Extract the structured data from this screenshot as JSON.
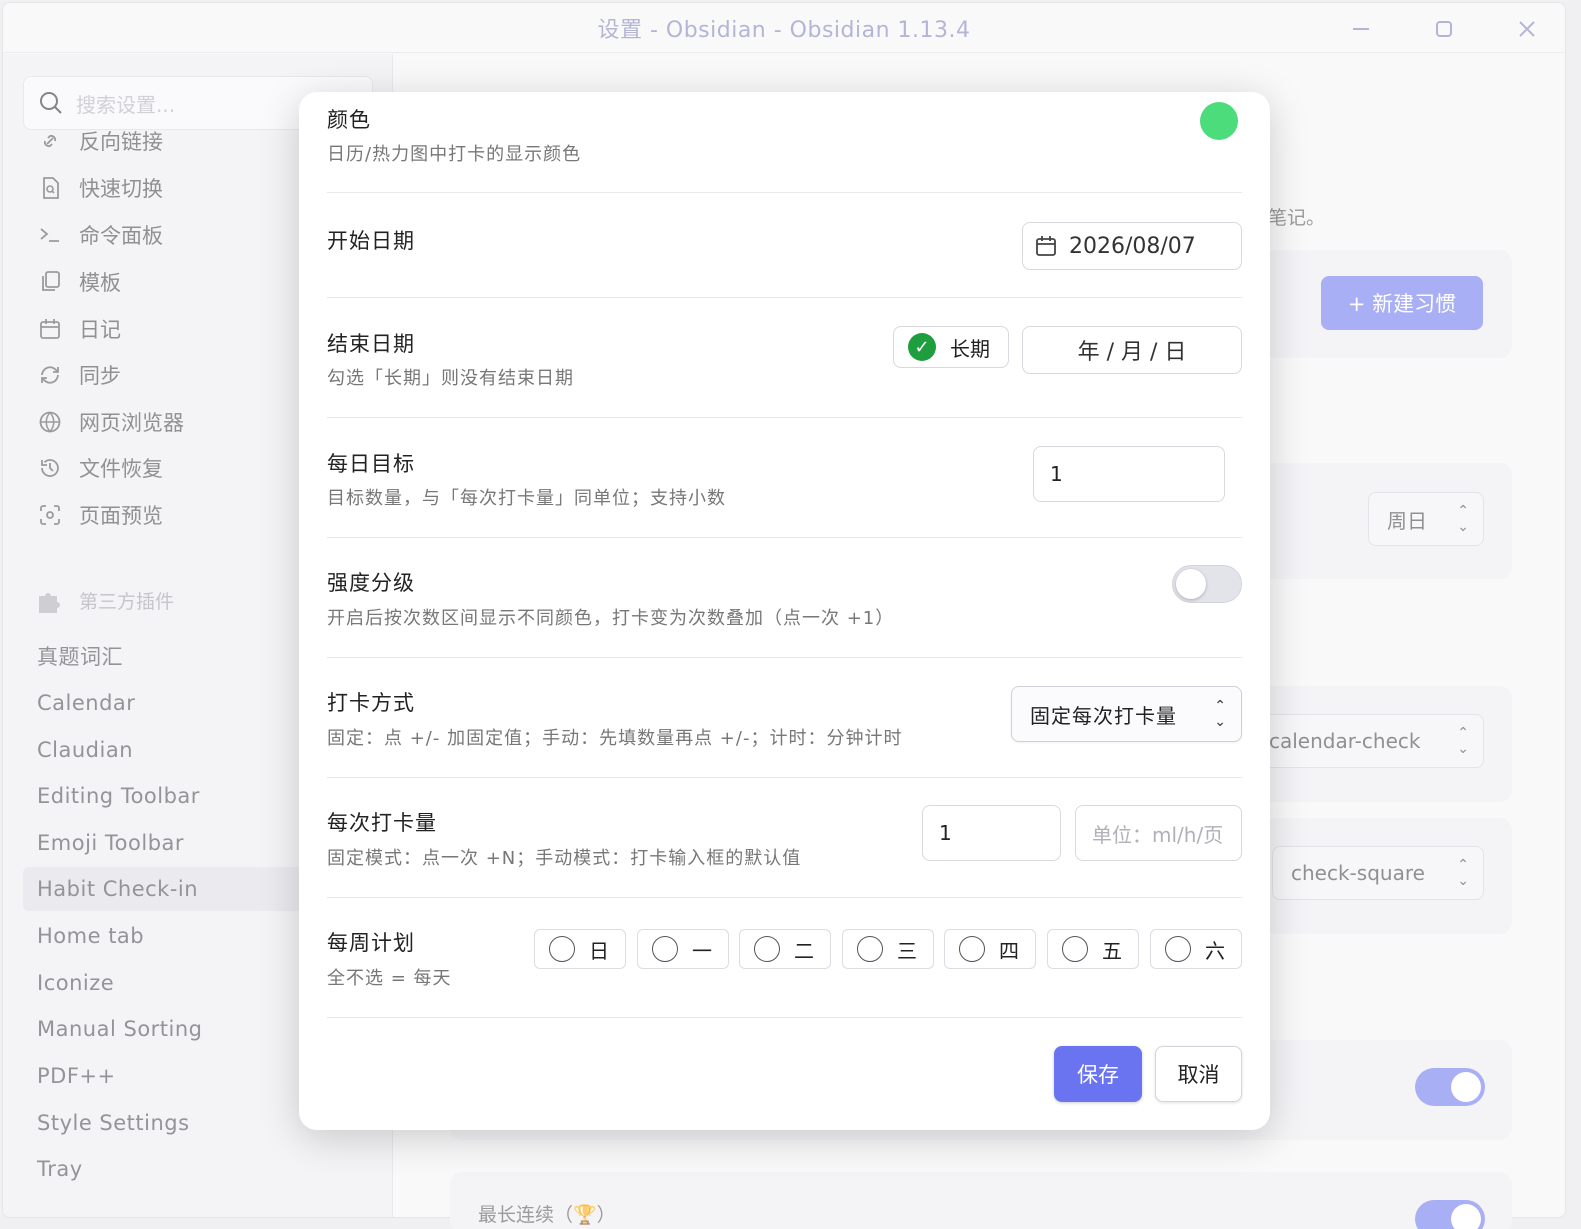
{
  "window": {
    "title": "设置 - Obsidian - Obsidian 1.13.4",
    "minimize_icon": "minimize-icon",
    "maximize_icon": "maximize-icon",
    "close_icon": "close-icon"
  },
  "sidebar": {
    "search_placeholder": "搜索设置...",
    "core_items": [
      {
        "label": "反向链接",
        "icon": "backlink-icon"
      },
      {
        "label": "快速切换",
        "icon": "file-search-icon"
      },
      {
        "label": "命令面板",
        "icon": "terminal-icon"
      },
      {
        "label": "模板",
        "icon": "files-icon"
      },
      {
        "label": "日记",
        "icon": "calendar-icon"
      },
      {
        "label": "同步",
        "icon": "sync-icon"
      },
      {
        "label": "网页浏览器",
        "icon": "globe-icon"
      },
      {
        "label": "文件恢复",
        "icon": "history-icon"
      },
      {
        "label": "页面预览",
        "icon": "scan-eye-icon"
      }
    ],
    "plugins_header": "第三方插件",
    "plugin_items": [
      "真题词汇",
      "Calendar",
      "Claudian",
      "Editing Toolbar",
      "Emoji Toolbar",
      "Habit Check-in",
      "Home tab",
      "Iconize",
      "Manual Sorting",
      "PDF++",
      "Style Settings",
      "Tray"
    ],
    "active_plugin": "Habit Check-in"
  },
  "background": {
    "notes_text": "笔记。",
    "new_habit_button": "+ 新建习惯",
    "week_start_select": "周日",
    "icon_select_1": "calendar-check",
    "icon_select_2": "check-square",
    "bottom_text": "最长连续（🏆）"
  },
  "modal": {
    "color": {
      "label": "颜色",
      "desc": "日历/热力图中打卡的显示颜色",
      "value": "#4cdc7c"
    },
    "start_date": {
      "label": "开始日期",
      "value": "2026/08/07"
    },
    "end_date": {
      "label": "结束日期",
      "desc": "勾选「长期」则没有结束日期",
      "longterm_label": "长期",
      "longterm_checked": true,
      "value": "年 / 月 / 日"
    },
    "daily_goal": {
      "label": "每日目标",
      "desc": "目标数量，与「每次打卡量」同单位；支持小数",
      "value": "1"
    },
    "intensity": {
      "label": "强度分级",
      "desc": "开启后按次数区间显示不同颜色，打卡变为次数叠加（点一次 +1）",
      "enabled": false
    },
    "checkin_mode": {
      "label": "打卡方式",
      "desc": "固定：点 +/- 加固定值；手动：先填数量再点 +/-；计时：分钟计时",
      "value": "固定每次打卡量"
    },
    "per_checkin": {
      "label": "每次打卡量",
      "desc": "固定模式：点一次 +N；手动模式：打卡输入框的默认值",
      "value": "1",
      "unit_placeholder": "单位：ml/h/页"
    },
    "weekly_plan": {
      "label": "每周计划",
      "desc": "全不选 = 每天",
      "days": [
        "日",
        "一",
        "二",
        "三",
        "四",
        "五",
        "六"
      ]
    },
    "save_label": "保存",
    "cancel_label": "取消"
  },
  "colors": {
    "accent": "#6a74f0",
    "habit_color": "#4cdc7c",
    "check_green": "#1e9e3e"
  }
}
